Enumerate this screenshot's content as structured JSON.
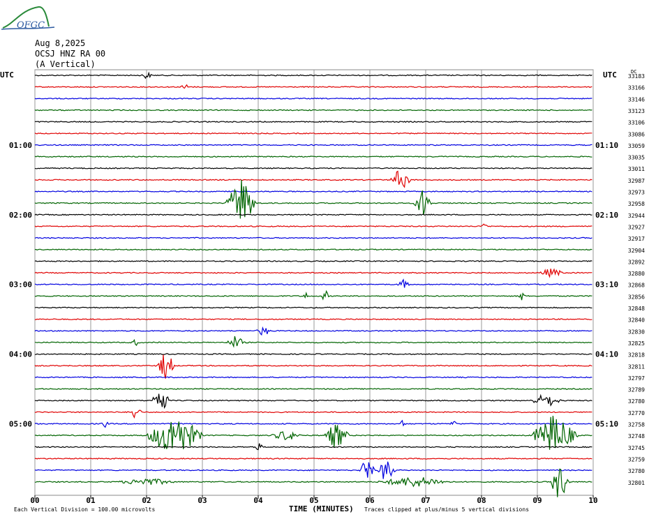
{
  "header": {
    "logo_text": "OFGC",
    "date": "Aug 8,2025",
    "station": "OCSJ HNZ RA 00",
    "component": "(A Vertical)"
  },
  "chart_data": {
    "type": "line",
    "title": "Aug 8,2025 OCSJ HNZ RA 00 (A Vertical)",
    "left_axis_label": "UTC",
    "right_axis_label": "UTC",
    "right_corner_label": "DC",
    "xlabel": "TIME (MINUTES)",
    "xlim": [
      0,
      10
    ],
    "x_ticks": [
      "00",
      "01",
      "02",
      "03",
      "04",
      "05",
      "06",
      "07",
      "08",
      "09",
      "10"
    ],
    "grid": true,
    "trace_colors": [
      "#000000",
      "#e00000",
      "#0000e0",
      "#006400"
    ],
    "left_time_labels": [
      {
        "trace": 6,
        "label": "01:00"
      },
      {
        "trace": 12,
        "label": "02:00"
      },
      {
        "trace": 18,
        "label": "03:00"
      },
      {
        "trace": 24,
        "label": "04:00"
      },
      {
        "trace": 30,
        "label": "05:00"
      }
    ],
    "right_time_labels": [
      {
        "trace": 6,
        "label": "01:10"
      },
      {
        "trace": 12,
        "label": "02:10"
      },
      {
        "trace": 18,
        "label": "03:10"
      },
      {
        "trace": 24,
        "label": "04:10"
      },
      {
        "trace": 30,
        "label": "05:10"
      }
    ],
    "dc_offsets": [
      33183,
      33166,
      33146,
      33123,
      33106,
      33086,
      33059,
      33035,
      33011,
      32987,
      32973,
      32958,
      32944,
      32927,
      32917,
      32904,
      32892,
      32880,
      32868,
      32856,
      32848,
      32840,
      32830,
      32825,
      32818,
      32811,
      32797,
      32789,
      32780,
      32770,
      32758,
      32748,
      32745,
      32759,
      32780,
      32801
    ],
    "events": [
      {
        "trace": 0,
        "minute": 2.0,
        "amplitude": 0.5,
        "duration": 0.1
      },
      {
        "trace": 1,
        "minute": 2.68,
        "amplitude": 0.6,
        "duration": 0.05
      },
      {
        "trace": 9,
        "minute": 6.55,
        "amplitude": 1.4,
        "duration": 0.3
      },
      {
        "trace": 11,
        "minute": 3.7,
        "amplitude": 3.0,
        "duration": 0.5
      },
      {
        "trace": 11,
        "minute": 6.95,
        "amplitude": 1.8,
        "duration": 0.25
      },
      {
        "trace": 13,
        "minute": 8.05,
        "amplitude": 0.5,
        "duration": 0.05
      },
      {
        "trace": 17,
        "minute": 9.25,
        "amplitude": 0.5,
        "duration": 0.4
      },
      {
        "trace": 18,
        "minute": 6.6,
        "amplitude": 0.5,
        "duration": 0.15
      },
      {
        "trace": 19,
        "minute": 4.85,
        "amplitude": 0.5,
        "duration": 0.05
      },
      {
        "trace": 19,
        "minute": 5.2,
        "amplitude": 0.8,
        "duration": 0.05
      },
      {
        "trace": 19,
        "minute": 8.72,
        "amplitude": 0.5,
        "duration": 0.05
      },
      {
        "trace": 22,
        "minute": 4.1,
        "amplitude": 0.6,
        "duration": 0.2
      },
      {
        "trace": 23,
        "minute": 1.8,
        "amplitude": 0.5,
        "duration": 0.05
      },
      {
        "trace": 23,
        "minute": 3.6,
        "amplitude": 0.8,
        "duration": 0.25
      },
      {
        "trace": 25,
        "minute": 2.35,
        "amplitude": 1.8,
        "duration": 0.25
      },
      {
        "trace": 28,
        "minute": 2.25,
        "amplitude": 1.8,
        "duration": 0.25
      },
      {
        "trace": 28,
        "minute": 9.15,
        "amplitude": 0.8,
        "duration": 0.5
      },
      {
        "trace": 29,
        "minute": 1.8,
        "amplitude": 1.0,
        "duration": 0.15
      },
      {
        "trace": 30,
        "minute": 1.25,
        "amplitude": 0.5,
        "duration": 0.05
      },
      {
        "trace": 30,
        "minute": 6.6,
        "amplitude": 0.5,
        "duration": 0.05
      },
      {
        "trace": 30,
        "minute": 7.5,
        "amplitude": 0.4,
        "duration": 0.05
      },
      {
        "trace": 31,
        "minute": 2.5,
        "amplitude": 2.6,
        "duration": 1.0
      },
      {
        "trace": 31,
        "minute": 4.5,
        "amplitude": 0.6,
        "duration": 0.5
      },
      {
        "trace": 31,
        "minute": 5.4,
        "amplitude": 1.6,
        "duration": 0.4
      },
      {
        "trace": 31,
        "minute": 9.3,
        "amplitude": 2.5,
        "duration": 0.8
      },
      {
        "trace": 32,
        "minute": 4.0,
        "amplitude": 0.5,
        "duration": 0.1
      },
      {
        "trace": 34,
        "minute": 5.95,
        "amplitude": 1.5,
        "duration": 0.2
      },
      {
        "trace": 34,
        "minute": 6.3,
        "amplitude": 1.5,
        "duration": 0.25
      },
      {
        "trace": 35,
        "minute": 2.0,
        "amplitude": 0.4,
        "duration": 1.0
      },
      {
        "trace": 35,
        "minute": 6.8,
        "amplitude": 0.6,
        "duration": 1.3
      },
      {
        "trace": 35,
        "minute": 9.4,
        "amplitude": 2.2,
        "duration": 0.3
      }
    ],
    "footer_left": "Each Vertical Division =  100.00 microvolts",
    "footer_right": "Traces clipped at plus/minus 5 vertical divisions"
  }
}
